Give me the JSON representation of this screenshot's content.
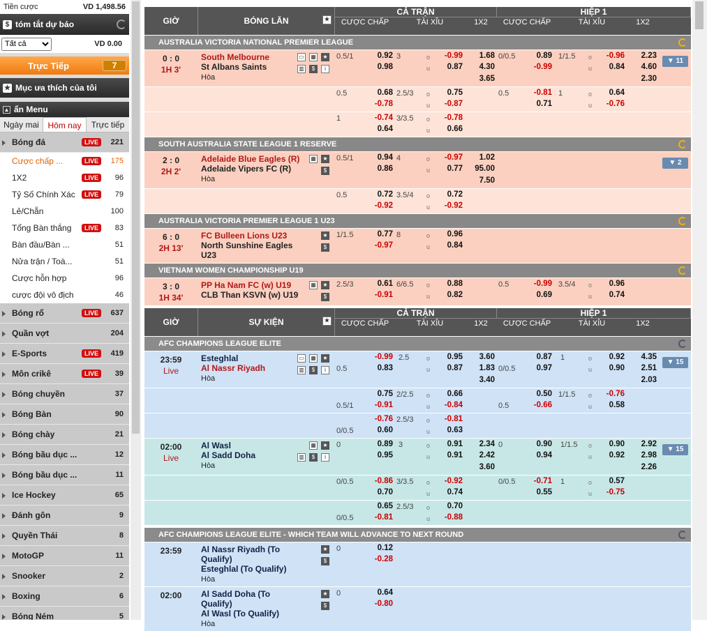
{
  "sidebar": {
    "credit_label": "Tiền cược",
    "credit_value": "VD  1,498.56",
    "summary_title": "tóm tắt dự báo",
    "filter_value": "Tất cả",
    "filter_amount": "VD 0.00",
    "live_label": "Trực Tiếp",
    "live_count": "7",
    "favorites": "Mục ưa thích của tôi",
    "menu_title": "ẩn Menu",
    "tabs": [
      "Ngày mai",
      "Hôm nay",
      "Trực tiếp"
    ],
    "football": {
      "name": "Bóng đá",
      "live": "LIVE",
      "count": "221"
    },
    "football_items": [
      {
        "name": "Cược chấp ...",
        "live": "LIVE",
        "count": "175"
      },
      {
        "name": "1X2",
        "live": "LIVE",
        "count": "96"
      },
      {
        "name": "Tỷ Số Chính Xác",
        "live": "LIVE",
        "count": "79"
      },
      {
        "name": "Lẻ/Chẵn",
        "live": "",
        "count": "100"
      },
      {
        "name": "Tổng Bàn thắng",
        "live": "LIVE",
        "count": "83"
      },
      {
        "name": "Bàn đầu/Bàn ...",
        "live": "",
        "count": "51"
      },
      {
        "name": "Nửa trận / Toà...",
        "live": "",
        "count": "51"
      },
      {
        "name": "Cược hỗn hợp",
        "live": "",
        "count": "96"
      },
      {
        "name": "cược đội vô địch",
        "live": "",
        "count": "46"
      }
    ],
    "sports": [
      {
        "name": "Bóng rổ",
        "live": "LIVE",
        "count": "637"
      },
      {
        "name": "Quần vợt",
        "live": "",
        "count": "204"
      },
      {
        "name": "E-Sports",
        "live": "LIVE",
        "count": "419"
      },
      {
        "name": "Môn crikê",
        "live": "LIVE",
        "count": "39"
      },
      {
        "name": "Bóng chuyền",
        "live": "",
        "count": "37"
      },
      {
        "name": "Bóng Bàn",
        "live": "",
        "count": "90"
      },
      {
        "name": "Bóng chày",
        "live": "",
        "count": "21"
      },
      {
        "name": "Bóng bầu dục ...",
        "live": "",
        "count": "12"
      },
      {
        "name": "Bóng bầu dục ...",
        "live": "",
        "count": "11"
      },
      {
        "name": "Ice Hockey",
        "live": "",
        "count": "65"
      },
      {
        "name": "Đánh gôn",
        "live": "",
        "count": "9"
      },
      {
        "name": "Quyền Thái",
        "live": "",
        "count": "8"
      },
      {
        "name": "MotoGP",
        "live": "",
        "count": "11"
      },
      {
        "name": "Snooker",
        "live": "",
        "count": "2"
      },
      {
        "name": "Boxing",
        "live": "",
        "count": "6"
      },
      {
        "name": "Bóng Ném",
        "live": "",
        "count": "5"
      }
    ]
  },
  "header1": {
    "time": "GIỜ",
    "event": "BÓNG LĂN",
    "full": "CẢ TRẬN",
    "half": "HIỆP 1",
    "hdp": "CƯỢC CHẤP",
    "ou": "TÀI XỈU",
    "x12": "1X2"
  },
  "header2": {
    "time": "GIỜ",
    "event": "SỰ KIỆN",
    "full": "CẢ TRẬN",
    "half": "HIỆP 1",
    "hdp": "CƯỢC CHẤP",
    "ou": "TÀI XỈU",
    "x12": "1X2"
  },
  "live_leagues": [
    {
      "name": "AUSTRALIA VICTORIA NATIONAL PREMIER LEAGUE"
    },
    {
      "name": "SOUTH AUSTRALIA STATE LEAGUE 1 RESERVE"
    },
    {
      "name": "AUSTRALIA VICTORIA PREMIER LEAGUE 1 U23"
    },
    {
      "name": "VIETNAM WOMEN CHAMPIONSHIP U19"
    }
  ],
  "m1": {
    "score": "0 : 0",
    "period": "1H 3'",
    "home": "South Melbourne",
    "away": "St Albans Saints",
    "draw": "Hòa",
    "more": "▼ 11",
    "r1": {
      "hdp": "0.5/1",
      "h": "0.92",
      "a": "0.98",
      "ou": "3",
      "o": "-0.99",
      "u": "0.87",
      "x1": "1.68",
      "x2": "4.30",
      "x3": "3.65",
      "hhdp": "0/0.5",
      "hh": "0.89",
      "ha": "-0.99",
      "hou": "1/1.5",
      "ho": "-0.96",
      "hu": "0.84",
      "hx1": "2.23",
      "hx2": "4.60",
      "hx3": "2.30"
    },
    "r2": {
      "hdp": "0.5",
      "h": "0.68",
      "a": "-0.78",
      "ou": "2.5/3",
      "o": "0.75",
      "u": "-0.87",
      "hhdp": "0.5",
      "hh": "-0.81",
      "ha": "0.71",
      "hou": "1",
      "ho": "0.64",
      "hu": "-0.76"
    },
    "r3": {
      "hdp": "1",
      "h": "-0.74",
      "a": "0.64",
      "ou": "3/3.5",
      "o": "-0.78",
      "u": "0.66"
    }
  },
  "m2": {
    "score": "2 : 0",
    "period": "2H 2'",
    "home": "Adelaide Blue Eagles (R)",
    "away": "Adelaide Vipers FC (R)",
    "draw": "Hòa",
    "more": "▼ 2",
    "r1": {
      "hdp": "0.5/1",
      "h": "0.94",
      "a": "0.86",
      "ou": "4",
      "o": "-0.97",
      "u": "0.77",
      "x1": "1.02",
      "x2": "95.00",
      "x3": "7.50"
    },
    "r2": {
      "hdp": "0.5",
      "h": "0.72",
      "a": "-0.92",
      "ou": "3.5/4",
      "o": "0.72",
      "u": "-0.92"
    }
  },
  "m3": {
    "score": "6 : 0",
    "period": "2H 13'",
    "home": "FC Bulleen Lions U23",
    "away": "North Sunshine Eagles U23",
    "r1": {
      "hdp": "1/1.5",
      "h": "0.77",
      "a": "-0.97",
      "ou": "8",
      "o": "0.96",
      "u": "0.84"
    }
  },
  "m4": {
    "score": "3 : 0",
    "period": "1H 34'",
    "home": "PP Ha Nam FC (w) U19",
    "away": "CLB Than KSVN (w) U19",
    "r1": {
      "hdp": "2.5/3",
      "h": "0.61",
      "a": "-0.91",
      "ou": "6/6.5",
      "o": "0.88",
      "u": "0.82",
      "hhdp": "0.5",
      "hh": "-0.99",
      "ha": "0.69",
      "hou": "3.5/4",
      "ho": "0.96",
      "hu": "0.74"
    }
  },
  "today_leagues": [
    {
      "name": "AFC CHAMPIONS LEAGUE ELITE"
    },
    {
      "name": "AFC CHAMPIONS LEAGUE ELITE - WHICH TEAM WILL ADVANCE TO NEXT ROUND"
    }
  ],
  "m5": {
    "time": "23:59",
    "status": "Live",
    "home": "Esteghlal",
    "away": "Al Nassr Riyadh",
    "draw": "Hòa",
    "more": "▼ 15",
    "r1": {
      "hdp": "0.5",
      "h": "-0.99",
      "a": "0.83",
      "ou": "2.5",
      "o": "0.95",
      "u": "0.87",
      "x1": "3.60",
      "x2": "1.83",
      "x3": "3.40",
      "hhdp": "0/0.5",
      "hh": "0.87",
      "ha": "0.97",
      "hou": "1",
      "ho": "0.92",
      "hu": "0.90",
      "hx1": "4.35",
      "hx2": "2.51",
      "hx3": "2.03"
    },
    "r2": {
      "hdp": "0.5/1",
      "h": "0.75",
      "a": "-0.91",
      "ou": "2/2.5",
      "o": "0.66",
      "u": "-0.84",
      "hhdp": "0.5",
      "hh": "0.50",
      "ha": "-0.66",
      "hou": "1/1.5",
      "ho": "-0.76",
      "hu": "0.58"
    },
    "r3": {
      "hdp": "0/0.5",
      "h": "-0.76",
      "a": "0.60",
      "ou": "2.5/3",
      "o": "-0.81",
      "u": "0.63"
    }
  },
  "m6": {
    "time": "02:00",
    "status": "Live",
    "home": "Al Wasl",
    "away": "Al Sadd Doha",
    "draw": "Hòa",
    "more": "▼ 15",
    "r1": {
      "hdp": "0",
      "h": "0.89",
      "a": "0.95",
      "ou": "3",
      "o": "0.91",
      "u": "0.91",
      "x1": "2.34",
      "x2": "2.42",
      "x3": "3.60",
      "hhdp": "0",
      "hh": "0.90",
      "ha": "0.94",
      "hou": "1/1.5",
      "ho": "0.90",
      "hu": "0.92",
      "hx1": "2.92",
      "hx2": "2.98",
      "hx3": "2.26"
    },
    "r2": {
      "hdp": "0/0.5",
      "h": "-0.86",
      "a": "0.70",
      "ou": "3/3.5",
      "o": "-0.92",
      "u": "0.74",
      "hhdp": "0/0.5",
      "hh": "-0.71",
      "ha": "0.55",
      "hou": "1",
      "ho": "0.57",
      "hu": "-0.75"
    },
    "r3": {
      "hdp": "0/0.5",
      "h": "0.65",
      "a": "-0.81",
      "ou": "2.5/3",
      "o": "0.70",
      "u": "-0.88"
    }
  },
  "m7": {
    "time": "23:59",
    "home": "Al Nassr Riyadh (To Qualify)",
    "away": "Esteghlal (To Qualify)",
    "draw": "Hòa",
    "hdp": "0",
    "h": "0.12",
    "a": "-0.28"
  },
  "m8": {
    "time": "02:00",
    "home": "Al Sadd Doha (To Qualify)",
    "away": "Al Wasl (To Qualify)",
    "draw": "Hòa",
    "hdp": "0",
    "h": "0.64",
    "a": "-0.80"
  },
  "ou_o": "o",
  "ou_u": "u"
}
